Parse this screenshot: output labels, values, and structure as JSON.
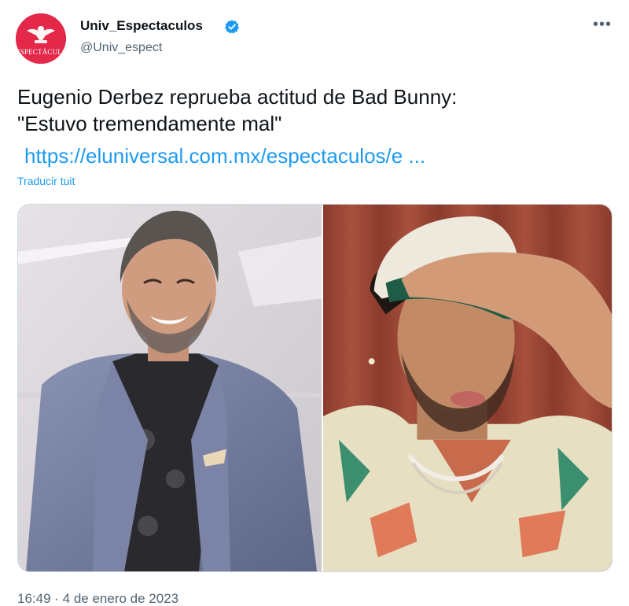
{
  "author": {
    "display_name": "Univ_Espectaculos",
    "handle": "@Univ_espect",
    "avatar_text": "ESPECTÁCULOS",
    "verified": true
  },
  "tweet": {
    "text_line1": "Eugenio Derbez reprueba actitud de Bad Bunny:",
    "text_line2": "\"Estuvo tremendamente mal\"",
    "link": "https://eluniversal.com.mx/espectaculos/e ...",
    "translate_label": "Traducir tuit"
  },
  "footer": {
    "timestamp": "16:49 · 4 de enero de 2023"
  },
  "icons": {
    "more": "more-options-icon",
    "verified": "verified-badge-icon"
  },
  "colors": {
    "brand_red": "#e3284a",
    "link_blue": "#1d9bf0",
    "muted": "#536471"
  }
}
